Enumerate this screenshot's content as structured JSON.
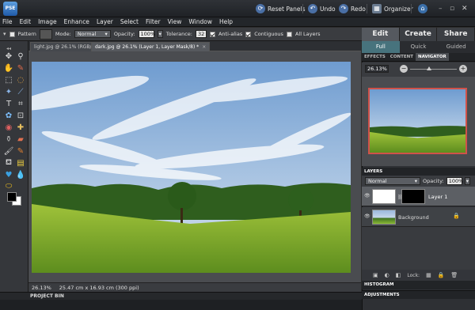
{
  "app": {
    "logo": "PSE"
  },
  "titlebar": {
    "reset_panels": "Reset Panels",
    "undo": "Undo",
    "redo": "Redo",
    "organizer": "Organizer"
  },
  "menu": [
    "File",
    "Edit",
    "Image",
    "Enhance",
    "Layer",
    "Select",
    "Filter",
    "View",
    "Window",
    "Help"
  ],
  "options": {
    "pattern_label": "Pattern",
    "mode_label": "Mode:",
    "mode_value": "Normal",
    "opacity_label": "Opacity:",
    "opacity_value": "100%",
    "tolerance_label": "Tolerance:",
    "tolerance_value": "32",
    "antialias_label": "Anti-alias",
    "contiguous_label": "Contiguous",
    "all_layers_label": "All Layers"
  },
  "doc_tabs": [
    {
      "label": "light.jpg @ 26.1% (RGB/8)",
      "close": "×"
    },
    {
      "label": "dark.jpg @ 26.1% (Layer 1, Layer Mask/8) *",
      "close": "×"
    }
  ],
  "status": {
    "zoom": "26.13%",
    "dimensions": "25.47 cm x 16.93 cm (300 ppi)"
  },
  "project_bin": "PROJECT BIN",
  "mode_tabs": [
    "Edit",
    "Create",
    "Share"
  ],
  "sub_tabs": [
    "Full",
    "Quick",
    "Guided"
  ],
  "panel_tabs": [
    "EFFECTS",
    "CONTENT",
    "NAVIGATOR"
  ],
  "navigator": {
    "zoom": "26.13%",
    "minus": "−",
    "plus": "+"
  },
  "layers": {
    "header": "LAYERS",
    "blend_mode": "Normal",
    "opacity_label": "Opacity:",
    "opacity_value": "100%",
    "items": [
      {
        "name": "Layer 1"
      },
      {
        "name": "Background"
      }
    ],
    "lock_label": "Lock:"
  },
  "histogram_header": "HISTOGRAM",
  "adjustments_header": "ADJUSTMENTS"
}
